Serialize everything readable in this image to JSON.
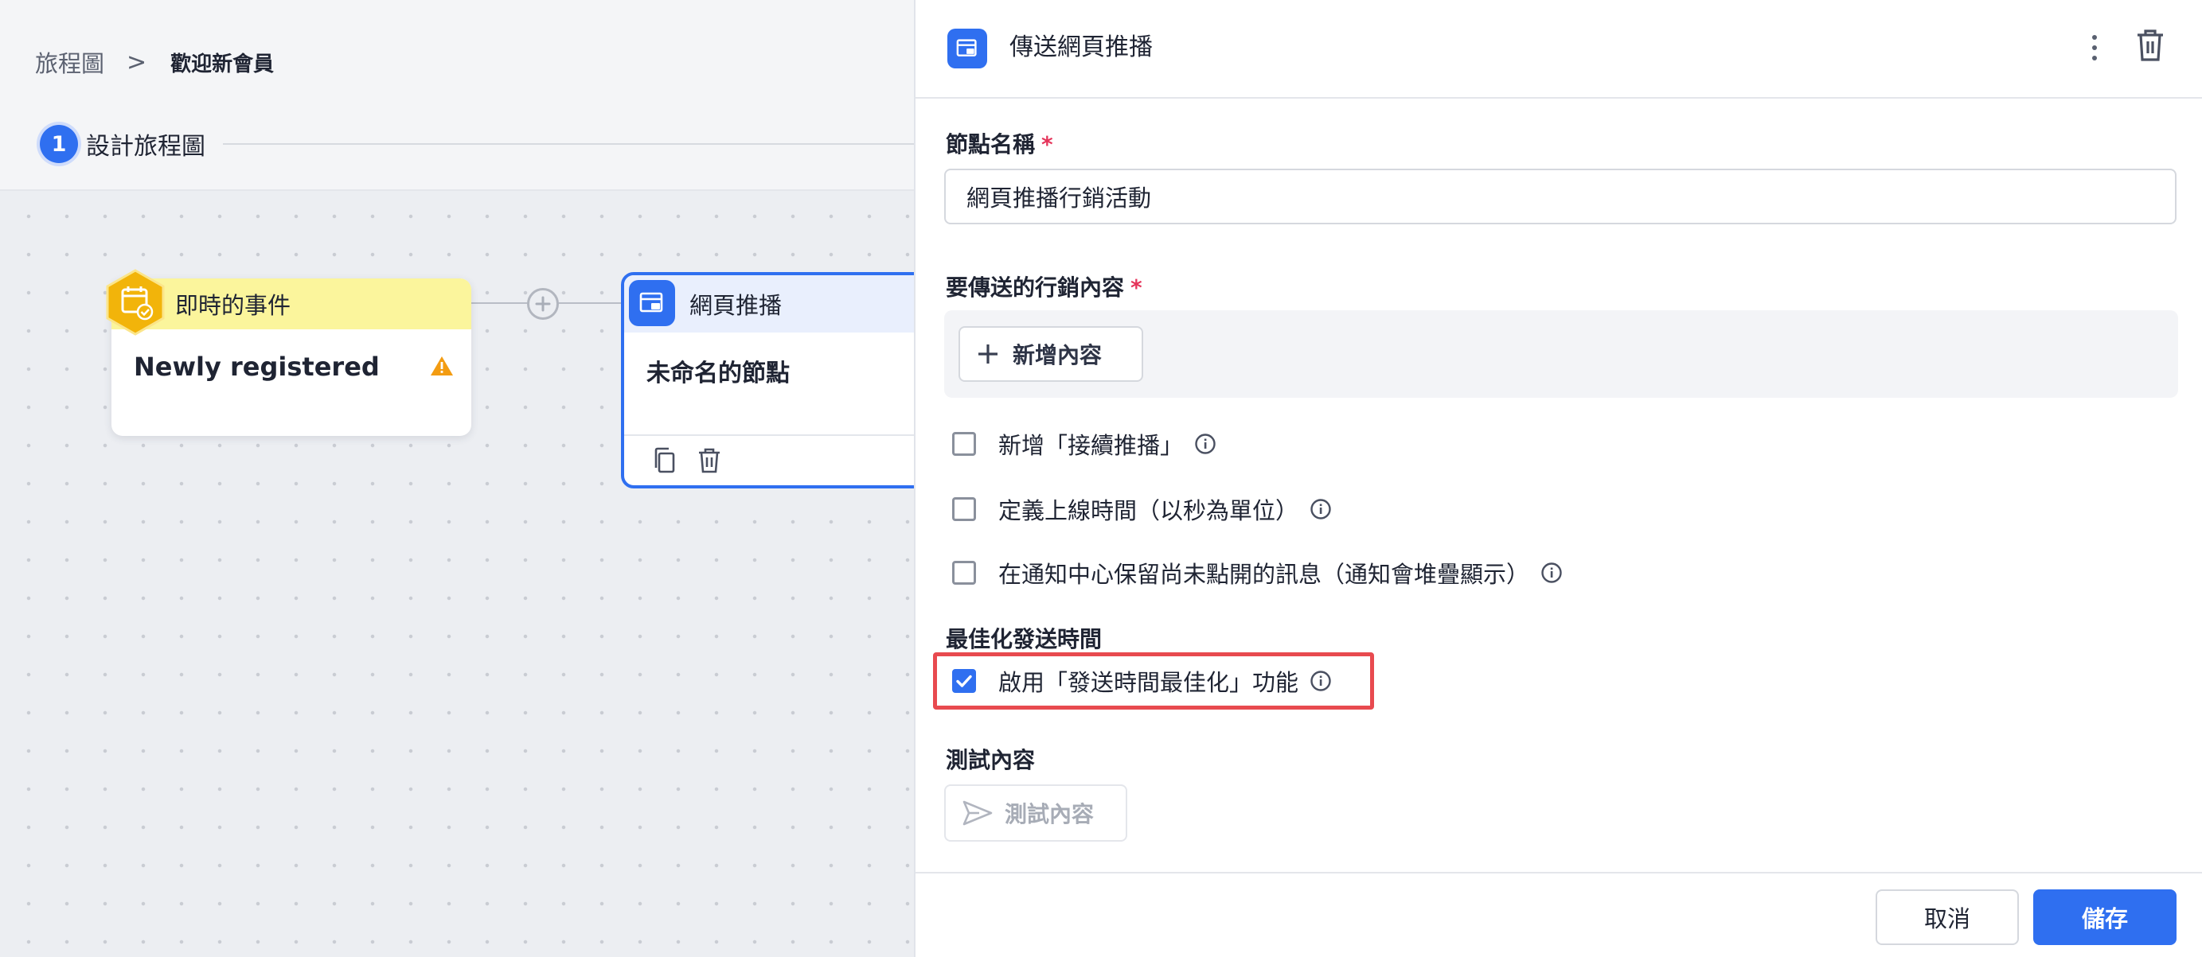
{
  "breadcrumb": {
    "root": "旅程圖",
    "separator": ">",
    "current": "歡迎新會員"
  },
  "stepper": {
    "number": "1",
    "label": "設計旅程圖"
  },
  "canvas": {
    "event_node": {
      "header": "即時的事件",
      "title": "Newly registered",
      "icon": "calendar-check-icon",
      "warning_icon": "warning-icon"
    },
    "push_node": {
      "header": "網頁推播",
      "title": "未命名的節點",
      "icon": "web-push-icon"
    }
  },
  "panel": {
    "title": "傳送網頁推播",
    "node_name": {
      "label": "節點名稱",
      "required_mark": "*",
      "value": "網頁推播行銷活動"
    },
    "content": {
      "label": "要傳送的行銷內容",
      "required_mark": "*",
      "add_button": "新增內容"
    },
    "options": [
      {
        "label": "新增「接續推播」",
        "checked": false
      },
      {
        "label": "定義上線時間（以秒為單位）",
        "checked": false
      },
      {
        "label": "在通知中心保留尚未點開的訊息（通知會堆疊顯示）",
        "checked": false
      }
    ],
    "optimization": {
      "heading": "最佳化發送時間",
      "label": "啟用「發送時間最佳化」功能",
      "checked": true
    },
    "test": {
      "heading": "測試內容",
      "button": "測試內容"
    },
    "footer": {
      "cancel": "取消",
      "save": "儲存"
    }
  },
  "colors": {
    "primary": "#2f6ff0",
    "event_header": "#fbf59c",
    "event_badge": "#f2b40a",
    "highlight": "#e84a4f",
    "required": "#e5355b"
  }
}
